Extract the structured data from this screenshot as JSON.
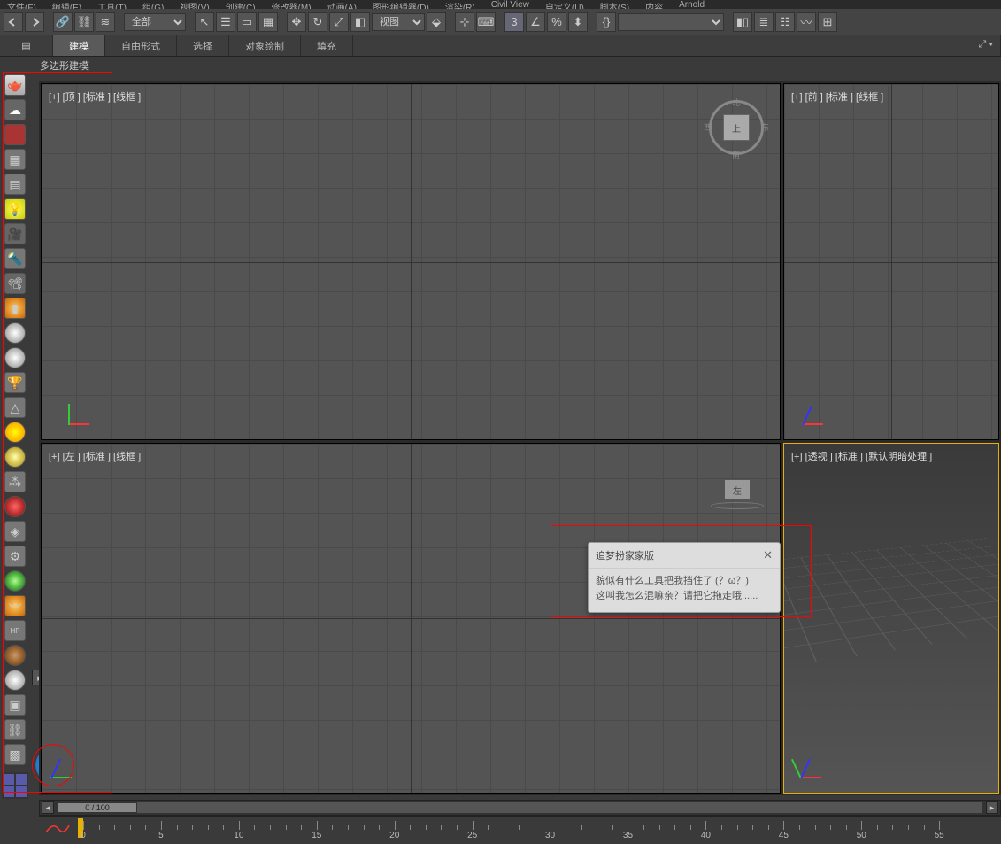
{
  "menubar": [
    "文件(F)",
    "编辑(E)",
    "工具(T)",
    "组(G)",
    "视图(V)",
    "创建(C)",
    "修改器(M)",
    "动画(A)",
    "图形编辑器(D)",
    "渲染(R)",
    "Civil View",
    "自定义(U)",
    "脚本(S)",
    "内容",
    "Arnold"
  ],
  "toolbar_dropdown_all": "全部",
  "toolbar_view_dropdown": "视图",
  "ribbon": {
    "tabs": [
      "建模",
      "自由形式",
      "选择",
      "对象绘制",
      "填充"
    ],
    "sub_label": "多边形建模"
  },
  "viewports": {
    "top": {
      "label": "[+] [顶 ] [标准 ] [线框 ]",
      "cube_face": "上",
      "compass": [
        "北",
        "东",
        "南",
        "西"
      ]
    },
    "front": {
      "label": "[+] [前 ] [标准 ] [线框 ]"
    },
    "left": {
      "label": "[+] [左 ] [标准 ] [线框 ]",
      "steer": "左"
    },
    "persp": {
      "label": "[+] [透视 ] [标准 ] [默认明暗处理 ]"
    }
  },
  "dialog": {
    "title": "追梦扮家家版",
    "line1": "貌似有什么工具把我挡住了 (？ω？)",
    "line2": "这叫我怎么混嘛亲？请把它拖走哦......"
  },
  "timeline": {
    "frame_label": "0  /  100",
    "ticks": [
      0,
      5,
      10,
      15,
      20,
      25,
      30,
      35,
      40,
      45,
      50,
      55
    ]
  },
  "left_icons": [
    "teapot",
    "cloud",
    "red-panel",
    "grid1",
    "grid2",
    "light-bulb",
    "camera1",
    "spot",
    "camera2",
    "book",
    "sphere-cream",
    "sphere-white",
    "trophy",
    "cone",
    "sun",
    "sphere-yellow",
    "particles",
    "sphere-red",
    "compass",
    "gear",
    "grass",
    "tail",
    "hp",
    "sphere-brown",
    "sphere-grey",
    "mat-lib",
    "chain",
    "slate",
    "red-light"
  ]
}
